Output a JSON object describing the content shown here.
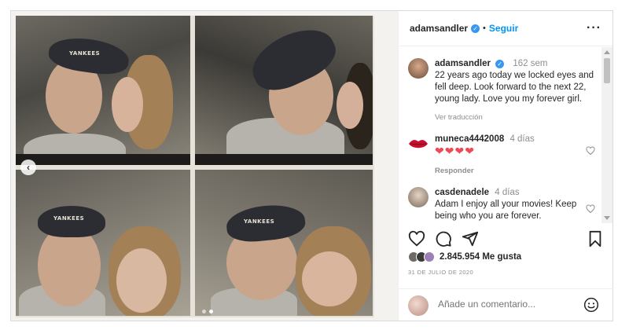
{
  "post": {
    "username": "adamsandler",
    "separator": "•",
    "follow_label": "Seguir",
    "more_label": "•••"
  },
  "caption": {
    "username": "adamsandler",
    "time": "162 sem",
    "text": "22 years ago today we locked eyes and fell deep. Look forward to the next 22, young lady. Love you my forever girl.",
    "translate": "Ver traducción"
  },
  "comments": [
    {
      "username": "muneca4442008",
      "time": "4 días",
      "text": "❤❤❤❤",
      "reply": "Responder"
    },
    {
      "username": "casdenadele",
      "time": "4 días",
      "text": "Adam I enjoy all your movies! Keep being who you are forever."
    }
  ],
  "likes": {
    "count_text": "2.845.954 Me gusta"
  },
  "date": "31 DE JULIO DE 2020",
  "add_comment": {
    "placeholder": "Añade un comentario..."
  },
  "photo": {
    "cap_text": "YANKEES",
    "carousel": {
      "total": 2,
      "active": 2
    }
  },
  "icons": {
    "verified": "verified-badge-icon",
    "like": "heart-icon",
    "comment": "comment-icon",
    "share": "paper-plane-icon",
    "save": "bookmark-icon",
    "emoji": "emoji-icon",
    "prev": "chevron-left-icon"
  },
  "colors": {
    "accent": "#0095f6",
    "verified": "#3897f0",
    "heart": "#ed4956"
  }
}
